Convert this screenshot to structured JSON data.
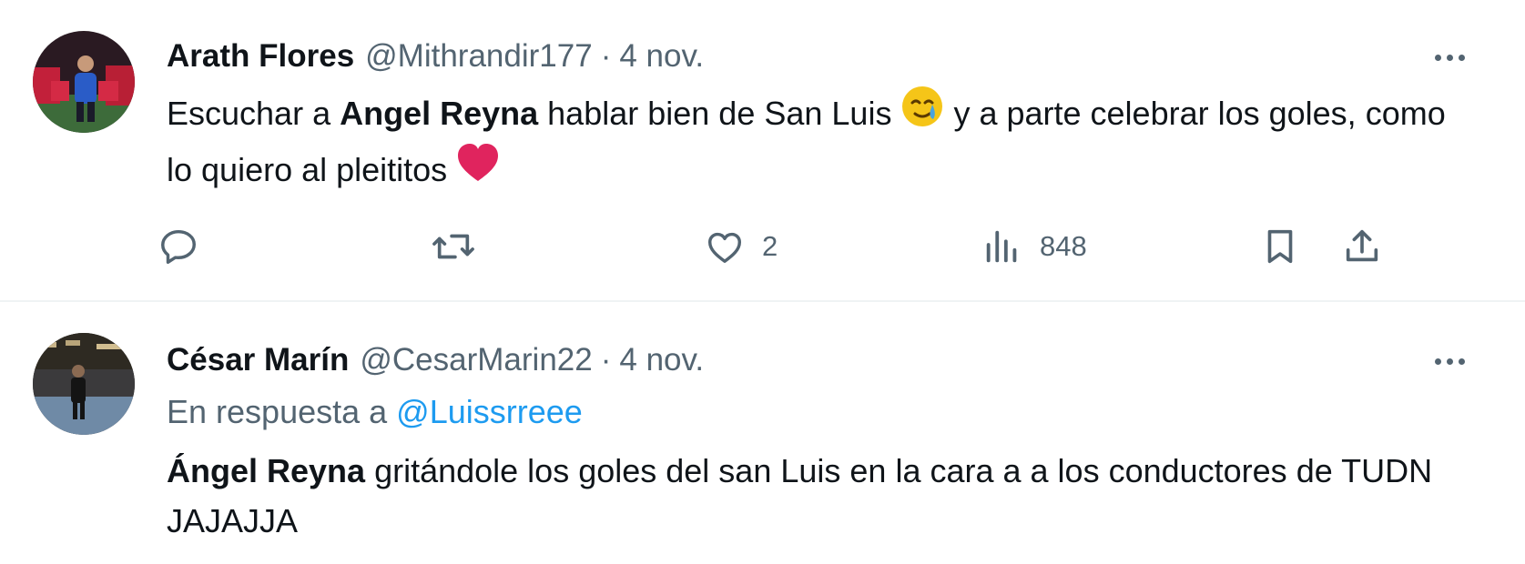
{
  "tweets": [
    {
      "display_name": "Arath Flores",
      "handle": "@Mithrandir177",
      "separator": "·",
      "date": "4 nov.",
      "text_segments": [
        {
          "text": "Escuchar a ",
          "bold": false
        },
        {
          "text": "Angel Reyna",
          "bold": true
        },
        {
          "text": " hablar bien de San Luis ",
          "bold": false
        },
        {
          "emoji": "face-holding-back-tears"
        },
        {
          "text": " y a parte celebrar los goles, como lo quiero al pleititos ",
          "bold": false
        },
        {
          "emoji": "red-heart"
        }
      ],
      "seg1": "Escuchar a ",
      "seg2": "Angel Reyna",
      "seg3": " hablar bien de San Luis ",
      "seg4": " y a parte celebrar los goles, como lo quiero al pleititos ",
      "actions": {
        "reply_icon": "reply-icon",
        "retweet_icon": "retweet-icon",
        "like_icon": "heart-icon",
        "like_count": "2",
        "views_icon": "analytics-icon",
        "views_count": "848",
        "bookmark_icon": "bookmark-icon",
        "share_icon": "share-icon"
      }
    },
    {
      "display_name": "César Marín",
      "handle": "@CesarMarin22",
      "separator": "·",
      "date": "4 nov.",
      "reply_prefix": "En respuesta a ",
      "reply_handle": "@Luissrreee",
      "seg1": "Ángel Reyna",
      "seg2": " gritándole los goles del san Luis en la cara a a los conductores de TUDN JAJAJJA"
    }
  ],
  "colors": {
    "text_primary": "#0f1419",
    "text_secondary": "#536471",
    "link": "#1d9bf0",
    "heart_emoji": "#e0245e",
    "divider": "#eff3f4"
  }
}
